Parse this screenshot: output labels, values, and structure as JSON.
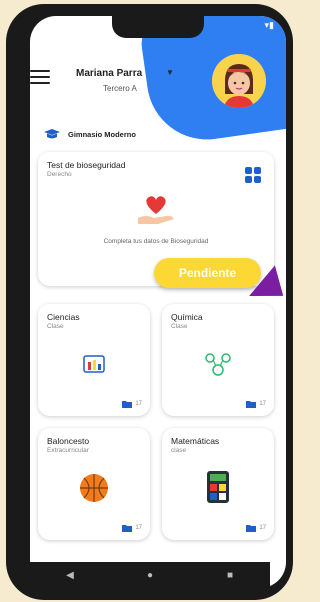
{
  "user": {
    "name": "Mariana Parra",
    "grade": "Tercero A"
  },
  "school": {
    "name": "Gimnasio Moderno"
  },
  "featured": {
    "title": "Test de bioseguridad",
    "subtitle": "Derecho",
    "caption": "Completa tus datos de Bioseguridad",
    "status": "Pendiente"
  },
  "subjects": [
    {
      "title": "Ciencias",
      "subtitle": "Clase",
      "count": "17"
    },
    {
      "title": "Química",
      "subtitle": "Clase",
      "count": "17"
    },
    {
      "title": "Baloncesto",
      "subtitle": "Extracurricular",
      "count": "17"
    },
    {
      "title": "Matemáticas",
      "subtitle": "clase",
      "count": "17"
    }
  ],
  "colors": {
    "accent": "#2f7ff3",
    "pending": "#fdd835",
    "arrow": "#7a1fa2",
    "background": "#f6ebcf"
  },
  "icons": [
    "menu-icon",
    "chevron-down-icon",
    "graduation-cap-icon",
    "grid-icon",
    "heart-hand-icon",
    "lab-icon",
    "molecule-icon",
    "basketball-icon",
    "calculator-icon",
    "folder-icon",
    "back-icon",
    "home-icon",
    "recent-icon"
  ]
}
